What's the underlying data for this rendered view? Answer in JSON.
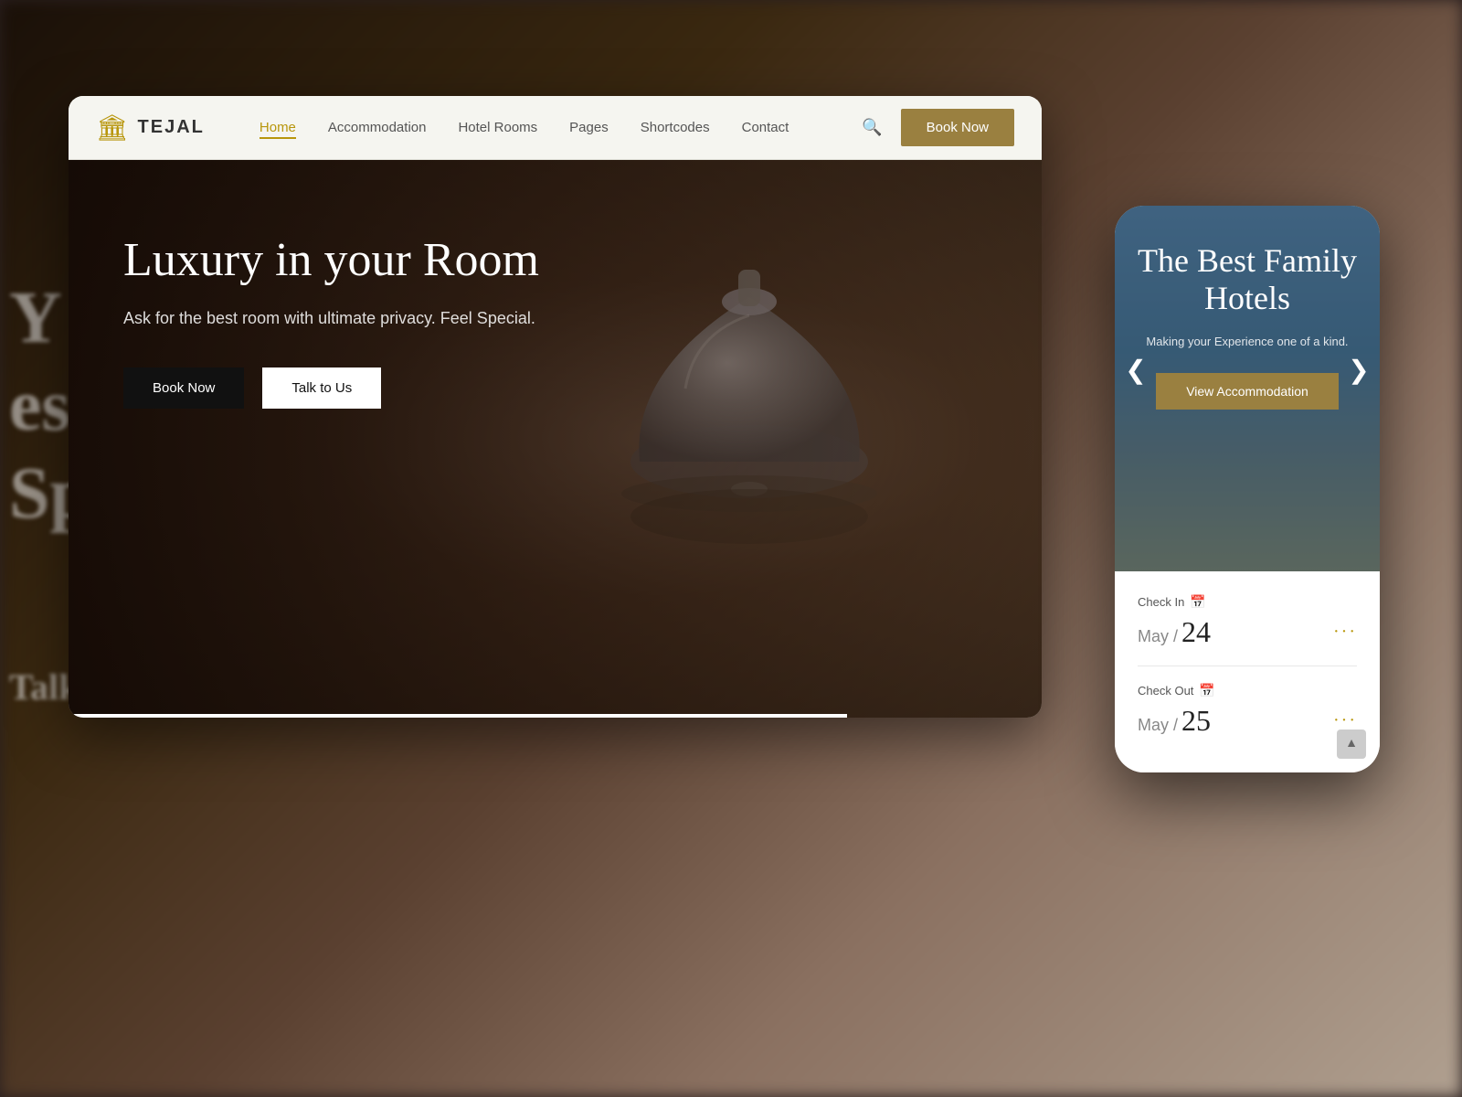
{
  "background": {
    "colors": [
      "#1a1008",
      "#3a2810",
      "#5a4030"
    ]
  },
  "left_blur_text": {
    "line1": "Y i",
    "line2": "est",
    "line3": "Sp",
    "line4": "Talk to"
  },
  "navbar": {
    "logo_icon": "🏛",
    "logo_text": "TEJAL",
    "links": [
      {
        "label": "Home",
        "active": true
      },
      {
        "label": "Accommodation",
        "active": false
      },
      {
        "label": "Hotel Rooms",
        "active": false
      },
      {
        "label": "Pages",
        "active": false
      },
      {
        "label": "Shortcodes",
        "active": false
      },
      {
        "label": "Contact",
        "active": false
      }
    ],
    "book_now_label": "Book Now"
  },
  "hero": {
    "title": "Luxury in your Room",
    "subtitle": "Ask for the best room with ultimate privacy. Feel Special.",
    "buttons": {
      "book_now": "Book Now",
      "talk_to_us": "Talk to Us"
    }
  },
  "mobile": {
    "hotel_title": "The Best Family Hotels",
    "hotel_subtitle": "Making your Experience one of a kind.",
    "view_accommodation": "View Accommodation",
    "carousel_arrow_left": "❮",
    "carousel_arrow_right": "❯",
    "checkin": {
      "label": "Check In",
      "month": "May /",
      "day": "24",
      "dots": "···"
    },
    "checkout": {
      "label": "Check Out",
      "month": "May /",
      "day": "25",
      "dots": "···"
    }
  }
}
